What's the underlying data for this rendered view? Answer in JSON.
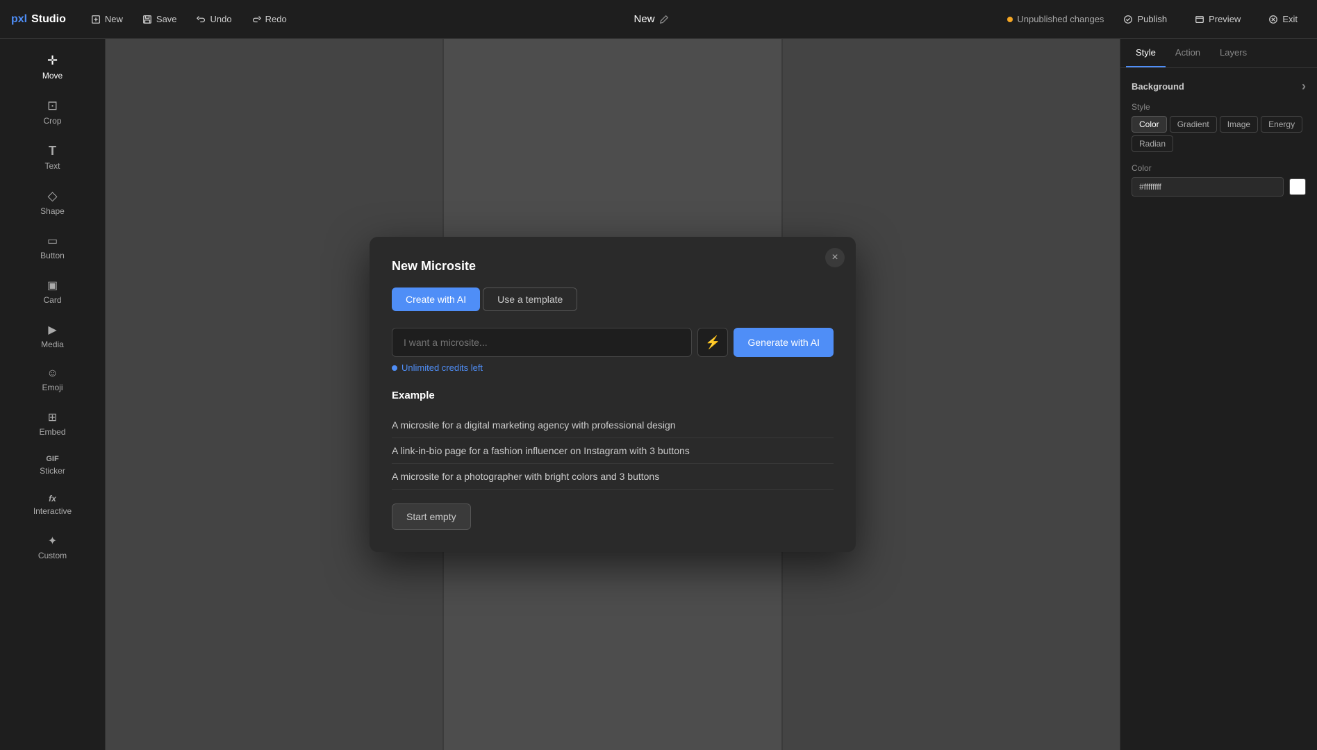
{
  "app": {
    "logo_px": "pxl",
    "logo_studio": " Studio"
  },
  "topbar": {
    "new_label": "New",
    "save_label": "Save",
    "undo_label": "Undo",
    "redo_label": "Redo",
    "page_title": "New",
    "unpublished_label": "Unpublished changes",
    "publish_label": "Publish",
    "preview_label": "Preview",
    "exit_label": "Exit"
  },
  "sidebar": {
    "items": [
      {
        "id": "move",
        "label": "Move",
        "icon": "+"
      },
      {
        "id": "crop",
        "label": "Crop",
        "icon": "✂"
      },
      {
        "id": "text",
        "label": "Text",
        "icon": "T"
      },
      {
        "id": "shape",
        "label": "Shape",
        "icon": "◇"
      },
      {
        "id": "button",
        "label": "Button",
        "icon": "▭"
      },
      {
        "id": "card",
        "label": "Card",
        "icon": "▣"
      },
      {
        "id": "media",
        "label": "Media",
        "icon": "▶"
      },
      {
        "id": "emoji",
        "label": "Emoji",
        "icon": "☺"
      },
      {
        "id": "embed",
        "label": "Embed",
        "icon": "⊞"
      },
      {
        "id": "sticker",
        "label": "Sticker",
        "icon": "GIF"
      },
      {
        "id": "interactive",
        "label": "Interactive",
        "icon": "fx"
      },
      {
        "id": "custom",
        "label": "Custom",
        "icon": "★"
      }
    ]
  },
  "right_panel": {
    "tabs": [
      {
        "id": "style",
        "label": "Style"
      },
      {
        "id": "action",
        "label": "Action"
      },
      {
        "id": "layers",
        "label": "Layers"
      }
    ],
    "active_tab": "style",
    "background_label": "Background",
    "style_label": "Style",
    "style_tabs": [
      {
        "id": "color",
        "label": "Color"
      },
      {
        "id": "gradient",
        "label": "Gradient"
      },
      {
        "id": "image",
        "label": "Image"
      },
      {
        "id": "energy",
        "label": "Energy"
      },
      {
        "id": "radiant",
        "label": "Radian"
      }
    ],
    "active_style_tab": "color",
    "color_label": "Color",
    "color_value": "#ffffffff",
    "chevron": "›"
  },
  "modal": {
    "title": "New Microsite",
    "close_icon": "×",
    "tabs": [
      {
        "id": "create_ai",
        "label": "Create with AI"
      },
      {
        "id": "use_template",
        "label": "Use a template"
      }
    ],
    "active_tab": "create_ai",
    "input_placeholder": "I want a microsite...",
    "lightning_icon": "⚡",
    "generate_btn_label": "Generate with AI",
    "credits_label": "Unlimited credits left",
    "example_section_label": "Example",
    "examples": [
      "A microsite for a digital marketing agency with professional design",
      "A link-in-bio page for a fashion influencer on Instagram with 3 buttons",
      "A microsite for a photographer with bright colors and 3 buttons"
    ],
    "start_empty_label": "Start empty"
  }
}
